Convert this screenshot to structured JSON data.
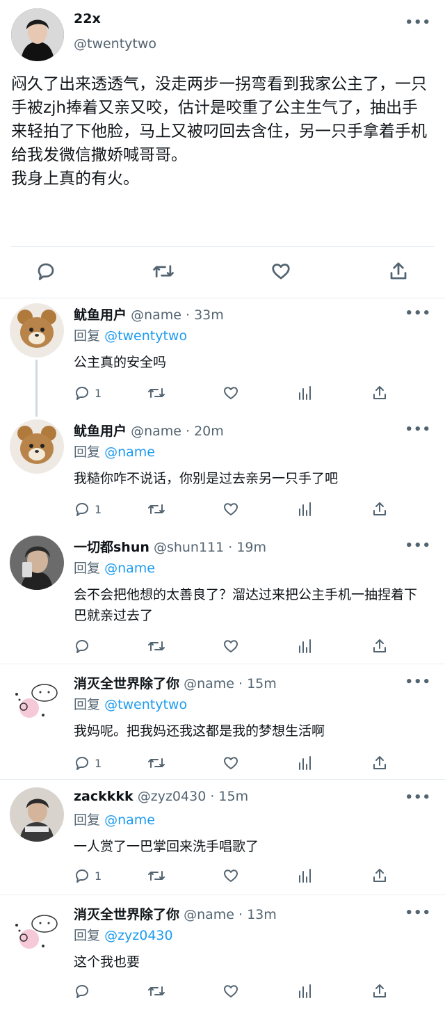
{
  "colors": {
    "accent": "#1d9bf0",
    "secondary_text": "#536471",
    "primary_text": "#0f1419",
    "divider": "#e6ecf0"
  },
  "main_tweet": {
    "name": "22x",
    "handle": "@twentytwo",
    "more": "•••",
    "text": "闷久了出来透透气，没走两步一拐弯看到我家公主了，一只手被zjh捧着又亲又咬，估计是咬重了公主生气了，抽出手来轻拍了下他脸，马上又被叼回去含住，另一只手拿着手机给我发微信撒娇喊哥哥。\n我身上真的有火。",
    "actions": [
      "reply-icon",
      "retweet-icon",
      "like-icon",
      "share-icon"
    ]
  },
  "replies": [
    {
      "name": "鱿鱼用户",
      "meta": "@name · 33m",
      "reply_prefix": "回复",
      "reply_to": "@twentytwo",
      "text": "公主真的安全吗",
      "reply_count": "1"
    },
    {
      "name": "鱿鱼用户",
      "meta": "@name · 20m",
      "reply_prefix": "回复",
      "reply_to": "@name",
      "text": "我糙你咋不说话，你别是过去亲另一只手了吧",
      "reply_count": "1"
    },
    {
      "name": "一切都shun",
      "meta": "@shun111 · 19m",
      "reply_prefix": "回复",
      "reply_to": "@name",
      "text": "会不会把他想的太善良了？溜达过来把公主手机一抽捏着下巴就亲过去了",
      "reply_count": ""
    },
    {
      "name": "消灭全世界除了你",
      "meta": "@name · 15m",
      "reply_prefix": "回复",
      "reply_to": "@twentytwo",
      "text": "我妈呢。把我妈还我这都是我的梦想生活啊",
      "reply_count": "1"
    },
    {
      "name": "zackkkk",
      "meta": "@zyz0430 · 15m",
      "reply_prefix": "回复",
      "reply_to": "@name",
      "text": "一人赏了一巴掌回来洗手唱歌了",
      "reply_count": "1"
    },
    {
      "name": "消灭全世界除了你",
      "meta": "@name · 13m",
      "reply_prefix": "回复",
      "reply_to": "@zyz0430",
      "text": "这个我也要",
      "reply_count": ""
    }
  ]
}
